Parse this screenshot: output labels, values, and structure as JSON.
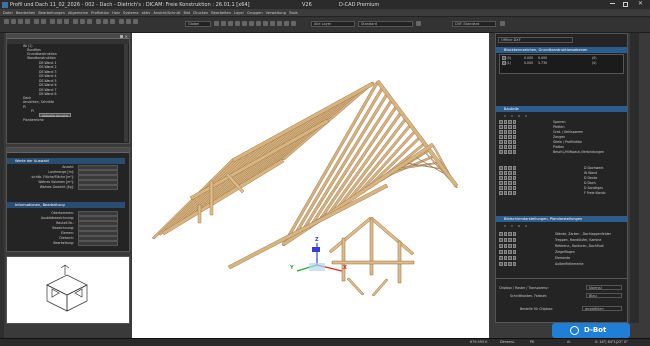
{
  "window": {
    "title": "Profil und Dach 11_02_2026 - 002 - Dach - Dietrich's : DICAM: Freie Konstruktion : 26.01.1 [x64]",
    "product": "D-CAD Premium",
    "version": "V26"
  },
  "menu": [
    "Datei",
    "Bearbeiten",
    "Bearbeitungen",
    "Allgemeine",
    "Profilation",
    "Holz",
    "Systeme",
    "aktiv",
    "Ansicht/Schnitt",
    "Bild",
    "Drucken",
    "Bearbeiten",
    "Layer",
    "Gruppen",
    "Verwaltung",
    "Tools"
  ],
  "toolbar": {
    "dropdowns": [
      "Globel",
      "Alle Layer",
      "Standard",
      "DXF-Standard"
    ]
  },
  "left_tree": {
    "rows": [
      "Wi (1)",
      "Rundfies",
      "Grundkonstruktion",
      "Wandkonstruktion",
      "DE-Wand 1",
      "DE-Wand 2",
      "DE-Wand 3",
      "DE-Wand 4",
      "DE-Wand 5",
      "DE-Wand 6",
      "DE-Wand 7",
      "DE-Wand 8",
      "Dach",
      "Ansichten, Schnitte",
      "Pl",
      "Pl",
      "Aktuelle Ansicht",
      "Planbereiche"
    ],
    "selected": "Aktuelle Ansicht"
  },
  "props": {
    "header1": "Werte der Auswahl",
    "rows1": [
      "Anzahl:",
      "Laufmenge [m]:",
      "sichtb. Fläche/Fläche [m²]:",
      "Wahres Volumen [m³]:",
      "Wahres Gewicht [kg]:"
    ],
    "header2": "Informationen, Bearbeitung",
    "rows2": [
      "Oberkommen:",
      "Ausbildbezeichnung:",
      "Bauteil-Nr.:",
      "Bezeichnung:",
      "Elemen:",
      "Dietarch:",
      "Bearbeitung:"
    ]
  },
  "viewport": {
    "axes": {
      "x": "X",
      "y": "Y",
      "z": "Z"
    }
  },
  "right_panel": {
    "dropdown": "Offline DXF",
    "header1": "Blockkennzeichen, Grundkonstruktionsebenen",
    "block_rows": [
      {
        "id": "(0)",
        "a": "0.000",
        "b": "0.000",
        "c": "(0)"
      },
      {
        "id": "(1)",
        "a": "0.000",
        "b": "5.730",
        "c": "(0)"
      }
    ],
    "header2": "Bauteile",
    "part_rows": [
      "Sparren",
      "Pfetten",
      "Grat- / Kehlsparren",
      "Zangen",
      "Stiele / Profilstäbe",
      "Platten",
      "Beschl./Hilfsbaut./Verbindungen"
    ],
    "sub_rows": [
      "D Dachwerk",
      "W Wand",
      "D Decke",
      "D Dach",
      "D Sonstiges",
      "F Freie Konstr."
    ],
    "header3": "Bildschirmdarstellungen, Plandarstellungen",
    "disp_rows": [
      "Stände, Zarken - Dachlappenfelder",
      "Treppen, Handläufer, Kamine",
      "Referenz-, Konturen, Dachflust",
      "Ziegelflagen",
      "Elemente",
      "Außenfiktlemente"
    ],
    "bottom_rows": [
      "Chipbox / Raster / Transparenz:",
      "Schnittkanten, Farbset:",
      "Bestelle für Chipbox:"
    ],
    "bottom_values": [
      "Normal",
      "Blau",
      "auswählen"
    ]
  },
  "dbot": {
    "label": "D-Bot"
  },
  "status": {
    "left": "679.593 K",
    "mid1": "Dimensi.",
    "mid2": "PK",
    "mid3": "rk",
    "right": "0: 16°| 64°1|22°  0°"
  }
}
